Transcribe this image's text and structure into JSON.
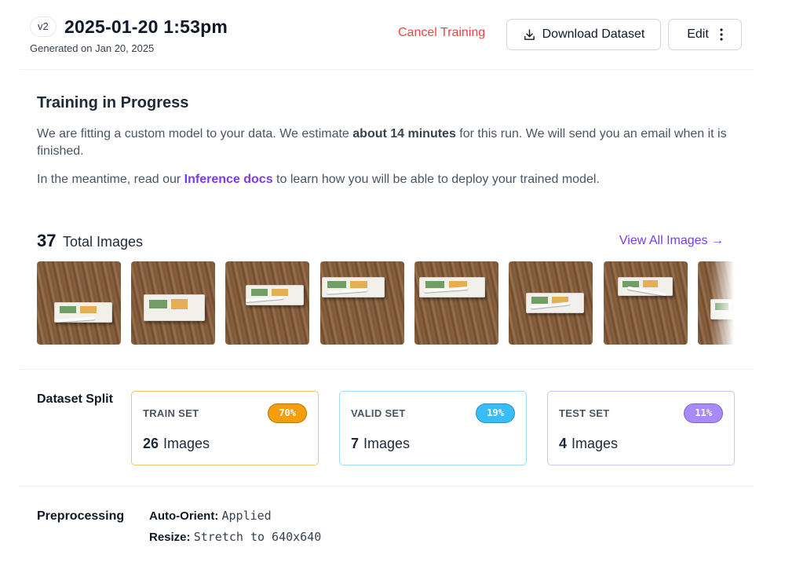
{
  "header": {
    "version_badge": "v2",
    "title": "2025-01-20 1:53pm",
    "generated": "Generated on Jan 20, 2025",
    "cancel_label": "Cancel Training",
    "download_label": "Download Dataset",
    "edit_label": "Edit"
  },
  "training": {
    "title": "Training in Progress",
    "p1_a": "We are fitting a custom model to your data. We estimate ",
    "p1_bold": "about 14 minutes",
    "p1_b": " for this run. We will send you an email when it is finished.",
    "p2_a": "In the meantime, read our ",
    "p2_link": "Inference docs",
    "p2_b": " to learn how you will be able to deploy your trained model."
  },
  "images": {
    "total": "37",
    "total_label": "Total Images",
    "view_all": "View All Images →"
  },
  "split": {
    "label": "Dataset Split",
    "cards": [
      {
        "title": "TRAIN SET",
        "pct": "70%",
        "count": "26",
        "unit": "Images",
        "color": "#f59e0b",
        "border": "#f6c463"
      },
      {
        "title": "VALID SET",
        "pct": "19%",
        "count": "7",
        "unit": "Images",
        "color": "#38bdf8",
        "border": "#9fdcf6"
      },
      {
        "title": "TEST SET",
        "pct": "11%",
        "count": "4",
        "unit": "Images",
        "color": "#a78bfa",
        "border": "#cfc2f8"
      }
    ]
  },
  "preprocessing": {
    "label": "Preprocessing",
    "items": [
      {
        "key": "Auto-Orient:",
        "value": "Applied"
      },
      {
        "key": "Resize:",
        "value": "Stretch to 640x640"
      }
    ]
  },
  "colors": {
    "accent": "#7c3aed",
    "danger": "#ef4444"
  }
}
